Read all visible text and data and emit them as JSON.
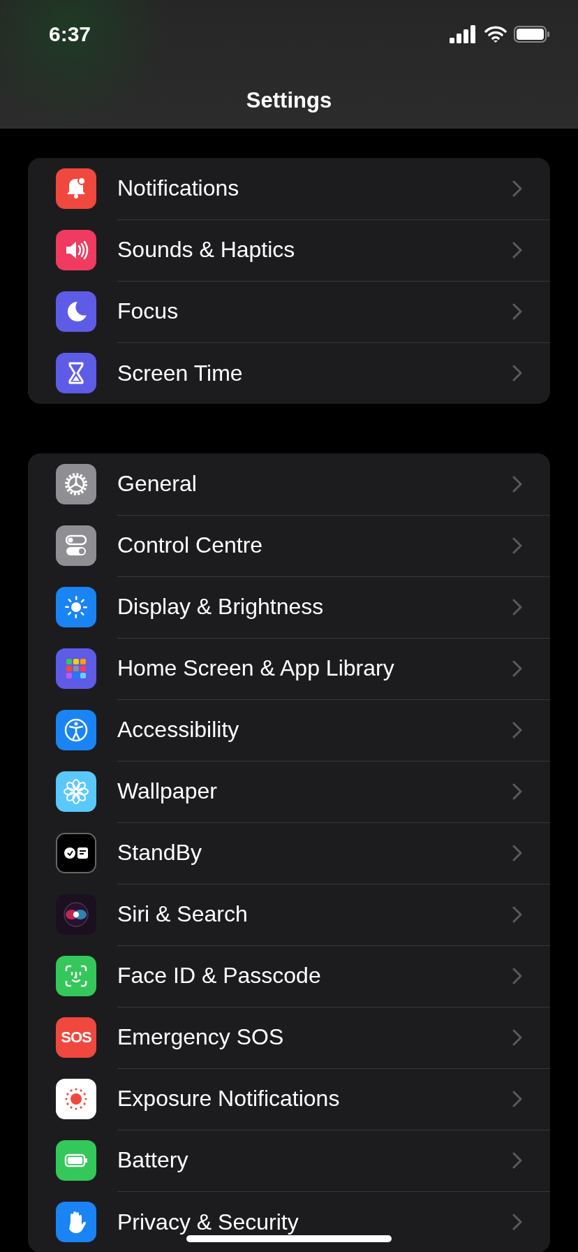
{
  "status_bar": {
    "time": "6:37"
  },
  "title": "Settings",
  "groups": [
    {
      "items": [
        {
          "label": "Notifications",
          "kind": "bell",
          "color": "#f0483e"
        },
        {
          "label": "Sounds & Haptics",
          "kind": "speaker",
          "color": "#f03a5f"
        },
        {
          "label": "Focus",
          "kind": "moon",
          "color": "#5e5ce6"
        },
        {
          "label": "Screen Time",
          "kind": "hourglass",
          "color": "#5e5ce6"
        }
      ]
    },
    {
      "items": [
        {
          "label": "General",
          "kind": "gear",
          "color": "#8e8e93"
        },
        {
          "label": "Control Centre",
          "kind": "toggles",
          "color": "#8e8e93"
        },
        {
          "label": "Display & Brightness",
          "kind": "sun",
          "color": "#1a84f5"
        },
        {
          "label": "Home Screen & App Library",
          "kind": "grid",
          "color": "#5e5ce6"
        },
        {
          "label": "Accessibility",
          "kind": "person",
          "color": "#1a84f5"
        },
        {
          "label": "Wallpaper",
          "kind": "flower",
          "color": "#5ac8fa"
        },
        {
          "label": "StandBy",
          "kind": "standby",
          "color": "#000000"
        },
        {
          "label": "Siri & Search",
          "kind": "siri",
          "color": "#1a1020"
        },
        {
          "label": "Face ID & Passcode",
          "kind": "face",
          "color": "#34c759"
        },
        {
          "label": "Emergency SOS",
          "kind": "sos",
          "color": "#f0483e",
          "icon_text": "SOS"
        },
        {
          "label": "Exposure Notifications",
          "kind": "exposure",
          "color": "#ffffff"
        },
        {
          "label": "Battery",
          "kind": "battery",
          "color": "#34c759"
        },
        {
          "label": "Privacy & Security",
          "kind": "hand",
          "color": "#1a84f5"
        }
      ]
    }
  ]
}
